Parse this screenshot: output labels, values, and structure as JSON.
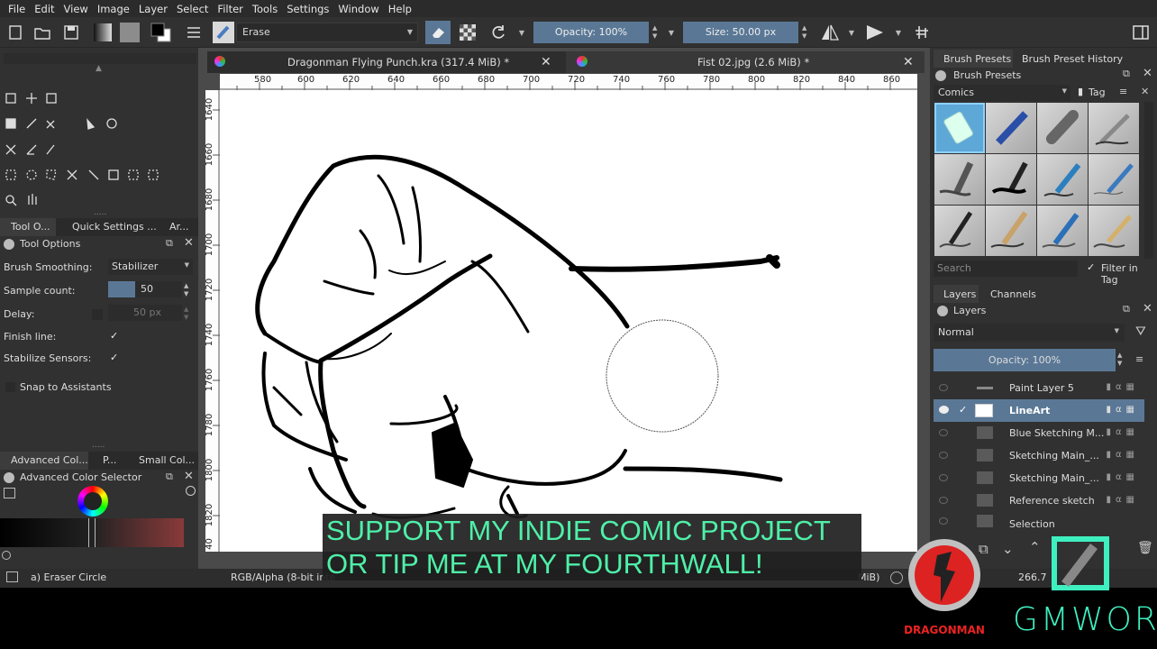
{
  "menu": [
    "File",
    "Edit",
    "View",
    "Image",
    "Layer",
    "Select",
    "Filter",
    "Tools",
    "Settings",
    "Window",
    "Help"
  ],
  "toolbar": {
    "brush_preset": "Erase",
    "opacity_label": "Opacity: 100%",
    "size_label": "Size: 50.00 px"
  },
  "doc_tabs": [
    {
      "title": "Dragonman Flying Punch.kra (317.4 MiB) *"
    },
    {
      "title": "Fist 02.jpg (2.6 MiB) *"
    }
  ],
  "ruler_h": [
    "580",
    "600",
    "620",
    "640",
    "660",
    "680",
    "700",
    "720",
    "740",
    "760",
    "780",
    "800",
    "820",
    "840",
    "860"
  ],
  "ruler_v": [
    "1640",
    "1660",
    "1680",
    "1700",
    "1720",
    "1740",
    "1760",
    "1780",
    "1800",
    "1820",
    "40"
  ],
  "left_tabs": {
    "tool_options": "Tool O...",
    "quick_settings": "Quick Settings ...",
    "ar": "Ar..."
  },
  "tool_options": {
    "title": "Tool Options",
    "brush_smoothing_label": "Brush Smoothing:",
    "brush_smoothing_value": "Stabilizer",
    "sample_count_label": "Sample count:",
    "sample_count_value": "50",
    "delay_label": "Delay:",
    "delay_value": "50 px",
    "finish_line_label": "Finish line:",
    "stabilize_sensors_label": "Stabilize Sensors:",
    "snap_label": "Snap to Assistants",
    "check": "✓"
  },
  "color_tabs": {
    "advanced": "Advanced Col...",
    "p": "P...",
    "small": "Small Col..."
  },
  "color_selector_title": "Advanced Color Selector",
  "right_tabs": {
    "brush_presets": "Brush Presets",
    "history": "Brush Preset History"
  },
  "brush_presets": {
    "title": "Brush Presets",
    "tag_combo": "Comics",
    "tag_label": "Tag",
    "search_placeholder": "Search",
    "filter_label": "Filter in Tag"
  },
  "layers_tabs": {
    "layers": "Layers",
    "channels": "Channels"
  },
  "layers": {
    "title": "Layers",
    "blend_mode": "Normal",
    "opacity_label": "Opacity:  100%",
    "items": [
      {
        "name": "Paint Layer 5"
      },
      {
        "name": "LineArt"
      },
      {
        "name": "Blue Sketching M..."
      },
      {
        "name": "Sketching Main_..."
      },
      {
        "name": "Sketching Main_..."
      },
      {
        "name": "Reference sketch"
      },
      {
        "name": "Selection"
      }
    ]
  },
  "status": {
    "tool": "a) Eraser Circle",
    "color_space": "RGB/Alpha (8-bit inte",
    "size_fragment": "MiB)",
    "zoom": "266.7"
  },
  "overlay": {
    "caption": "SUPPORT MY INDIE COMIC PROJECT\nOR TIP ME AT MY FOURTHWALL!",
    "logo_left": "DRAGONMAN",
    "logo_right": "GMWOR"
  }
}
